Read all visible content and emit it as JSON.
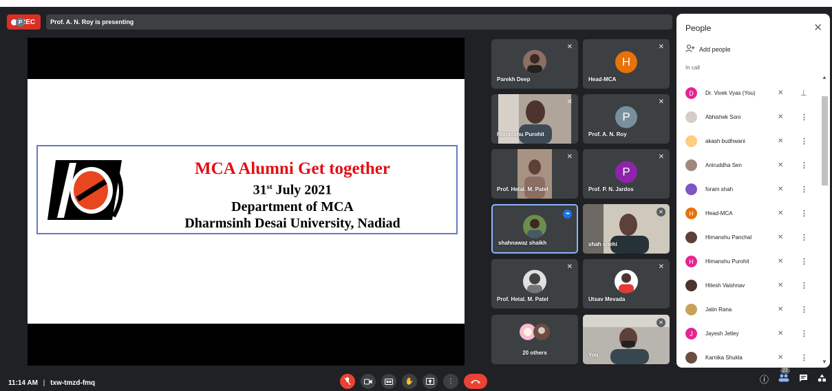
{
  "topbar": {
    "rec_label": "REC",
    "presenter_initial": "P",
    "presenting_text": "Prof. A. N. Roy is presenting"
  },
  "slide": {
    "title": "MCA Alumni Get together",
    "date_day": "31",
    "date_suffix": "st",
    "date_rest": "July 2021",
    "department": "Department of MCA",
    "university": "Dharmsinh Desai University, Nadiad"
  },
  "tiles": [
    {
      "name": "Parekh Deep",
      "type": "photo"
    },
    {
      "name": "Head-MCA",
      "type": "letter",
      "letter": "H",
      "color": "#e8710a"
    },
    {
      "name": "Himanshu Purohit",
      "type": "camera"
    },
    {
      "name": "Prof. A. N. Roy",
      "type": "letter",
      "letter": "P",
      "color": "#78909c"
    },
    {
      "name": "Prof. Hetal. M. Patel",
      "type": "camera"
    },
    {
      "name": "Prof. P. N. Jardos",
      "type": "letter",
      "letter": "P",
      "color": "#8e24aa"
    },
    {
      "name": "shahnawaz shaikh",
      "type": "photo"
    },
    {
      "name": "shah snehi",
      "type": "camera"
    },
    {
      "name": "Prof. Hetal. M. Patel",
      "type": "photo"
    },
    {
      "name": "Utsav Mevada",
      "type": "photo"
    },
    {
      "name": "20 others",
      "type": "group"
    },
    {
      "name": "You",
      "type": "camera"
    }
  ],
  "bottombar": {
    "time": "11:14 AM",
    "separator": "|",
    "meeting_code": "txw-tmzd-fmq",
    "participants_count": "22"
  },
  "panel": {
    "title": "People",
    "add_people": "Add people",
    "in_call": "In call",
    "people": [
      {
        "name": "Dr. Vivek Vyas (You)",
        "initial": "D",
        "color": "#e52592"
      },
      {
        "name": "Abhishek Soni",
        "initial": "",
        "color": "#d7ccc8"
      },
      {
        "name": "akash budhwani",
        "initial": "",
        "color": "#ffcc80"
      },
      {
        "name": "Aniruddha Sen",
        "initial": "",
        "color": "#a1887f"
      },
      {
        "name": "foram shah",
        "initial": "",
        "color": "#7e57c2"
      },
      {
        "name": "Head-MCA",
        "initial": "H",
        "color": "#e8710a"
      },
      {
        "name": "Himanshu Panchal",
        "initial": "",
        "color": "#5d4037"
      },
      {
        "name": "Himanshu Purohit",
        "initial": "H",
        "color": "#e52592"
      },
      {
        "name": "Hitesh Vaishnav",
        "initial": "",
        "color": "#4e342e"
      },
      {
        "name": "Jatin Rana",
        "initial": "",
        "color": "#c8a25a"
      },
      {
        "name": "Jayesh Jetley",
        "initial": "J",
        "color": "#e52592"
      },
      {
        "name": "Karnika Shukla",
        "initial": "",
        "color": "#6d4c41"
      }
    ]
  },
  "colors": {
    "background": "#202124",
    "tile": "#3c4043",
    "rec": "#d93025",
    "end_call": "#ea4335",
    "active_border": "#8ab4f8",
    "slide_title": "#e30f14"
  }
}
